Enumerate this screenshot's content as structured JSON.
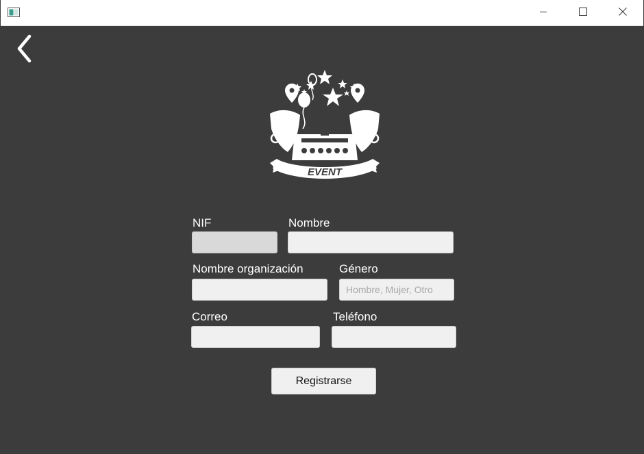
{
  "window": {
    "controls": {
      "minimize_icon": "minimize-icon",
      "maximize_icon": "maximize-icon",
      "close_icon": "close-icon"
    }
  },
  "nav": {
    "back_icon": "chevron-left-icon"
  },
  "logo": {
    "text": "EVENT"
  },
  "form": {
    "nif": {
      "label": "NIF",
      "value": ""
    },
    "nombre": {
      "label": "Nombre",
      "value": ""
    },
    "organizacion": {
      "label": "Nombre organización",
      "value": ""
    },
    "genero": {
      "label": "Género",
      "value": "",
      "placeholder": "Hombre, Mujer, Otro"
    },
    "correo": {
      "label": "Correo",
      "value": ""
    },
    "telefono": {
      "label": "Teléfono",
      "value": ""
    },
    "submit_label": "Registrarse"
  },
  "colors": {
    "background": "#3c3c3c",
    "field_background": "#f0f0f0",
    "field_disabled": "#d9d9d9",
    "text": "#ffffff"
  }
}
